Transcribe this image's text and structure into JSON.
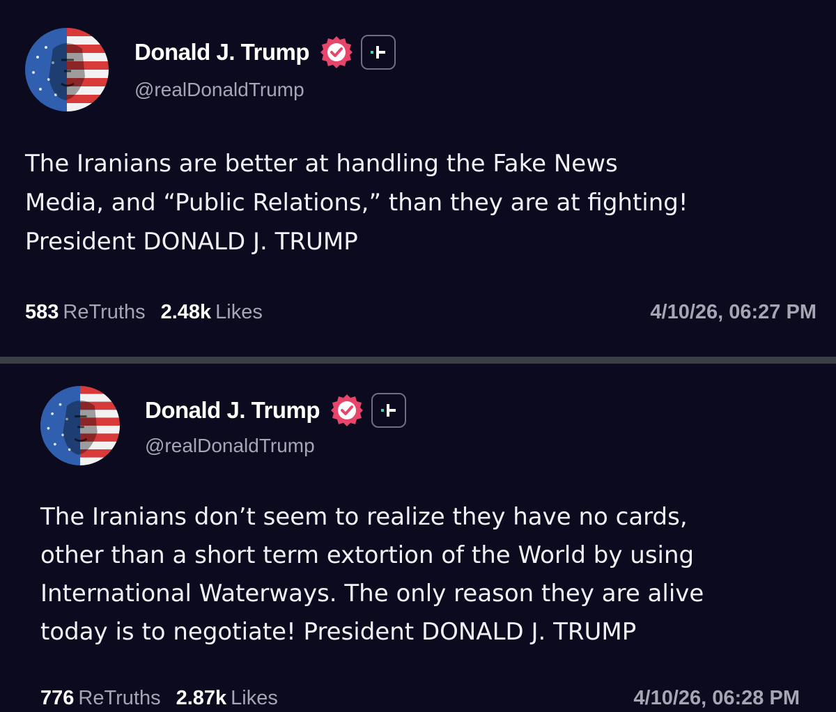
{
  "posts": [
    {
      "display_name": "Donald J. Trump",
      "handle": "@realDonaldTrump",
      "body": "The Iranians are better at handling the Fake News\nMedia, and “Public Relations,” than they are at fighting!\nPresident DONALD J. TRUMP",
      "retruths_count": "583",
      "retruths_label": "ReTruths",
      "likes_count": "2.48k",
      "likes_label": "Likes",
      "timestamp": "4/10/26, 06:27 PM"
    },
    {
      "display_name": "Donald J. Trump",
      "handle": "@realDonaldTrump",
      "body": "The Iranians don’t seem to realize they have no cards,\nother than a short term extortion of the World by using\nInternational Waterways. The only reason they are alive\ntoday is to negotiate! President DONALD J. TRUMP",
      "retruths_count": "776",
      "retruths_label": "ReTruths",
      "likes_count": "2.87k",
      "likes_label": "Likes",
      "timestamp": "4/10/26, 06:28 PM"
    }
  ],
  "colors": {
    "background": "#0b0a1e",
    "divider": "#3a3f47",
    "verified_badge": "#e8456a",
    "plus_badge_accent": "#3dd9b0",
    "muted_text": "#a4a6b3"
  },
  "icons": {
    "verified": "verified-badge-icon",
    "plus": "truth-plus-icon"
  }
}
